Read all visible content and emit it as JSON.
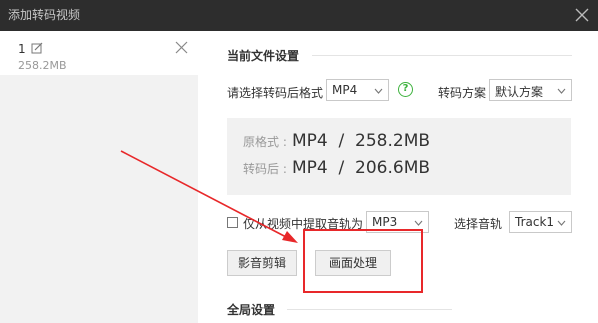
{
  "window": {
    "title": "添加转码视频",
    "close_icon": "close-icon"
  },
  "file_list": {
    "items": [
      {
        "index": "1",
        "size": "258.2MB",
        "edit_icon": "edit-icon",
        "remove_icon": "close-icon"
      }
    ]
  },
  "current_settings": {
    "section_title": "当前文件设置",
    "format_label": "请选择转码后格式",
    "format_value": "MP4",
    "help_icon": "question-icon",
    "help_glyph": "?",
    "scheme_label": "转码方案",
    "scheme_value": "默认方案",
    "original_label": "原格式 :",
    "original_value": "MP4  /  258.2MB",
    "converted_label": "转码后 :",
    "converted_value": "MP4  /  206.6MB",
    "audio_only_label": "仅从视频中提取音轨为",
    "audio_only_checked": false,
    "audio_format_value": "MP3",
    "audio_track_label": "选择音轨",
    "audio_track_value": "Track1",
    "edit_button": "影音剪辑",
    "picture_button": "画面处理"
  },
  "global_settings": {
    "section_title": "全局设置"
  },
  "colors": {
    "titlebar": "#2d2d2d",
    "accent_green": "#3db23d",
    "annotation_red": "#e8282a"
  }
}
